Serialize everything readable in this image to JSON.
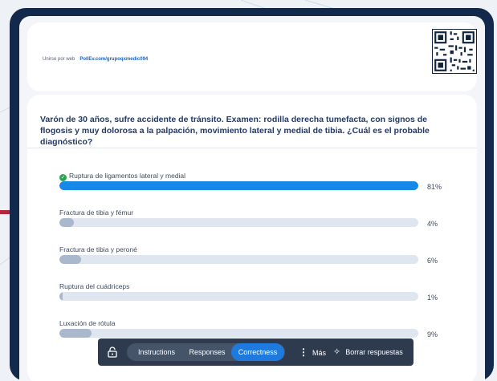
{
  "join": {
    "prefix": "Unirse por web",
    "url": "PollEv.com/grupoqxmedic094"
  },
  "question": "Varón de 30 años, sufre accidente de tránsito. Examen: rodilla derecha tumefacta, con signos de flogosis y muy dolorosa a la palpación, movimiento lateral y medial de tibia. ¿Cuál es el probable diagnóstico?",
  "options": [
    {
      "label": "Ruptura de ligamentos lateral y medial",
      "percent_label": "81%",
      "value": 81,
      "correct": true
    },
    {
      "label": "Fractura de tibia y fémur",
      "percent_label": "4%",
      "value": 4,
      "correct": false
    },
    {
      "label": "Fractura de tibia y peroné",
      "percent_label": "6%",
      "value": 6,
      "correct": false
    },
    {
      "label": "Ruptura del cuádriceps",
      "percent_label": "1%",
      "value": 1,
      "correct": false
    },
    {
      "label": "Luxación de rótula",
      "percent_label": "9%",
      "value": 9,
      "correct": false
    }
  ],
  "toolbar": {
    "instructions": "Instructions",
    "responses": "Responses",
    "correctness": "Correctness",
    "more": "Más",
    "clear": "Borrar respuestas",
    "active_tab": "correctness"
  },
  "colors": {
    "frame": "#13294b",
    "correct_bar": "#1588e8",
    "other_bar": "#a9b9cb",
    "accent_mark": "#b3263e"
  },
  "icons": {
    "lock": "lock-icon",
    "check": "check-circle-icon",
    "more": "more-vertical-icon",
    "clear": "sparkle-clear-icon"
  }
}
